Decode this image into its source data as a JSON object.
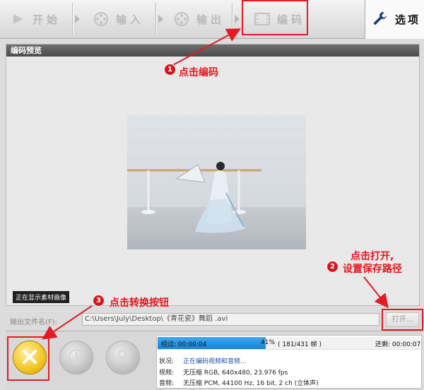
{
  "toolbar": {
    "start_label": "开始",
    "input_label": "输入",
    "output_label": "输出",
    "encode_label": "编码",
    "options_label": "选项"
  },
  "preview": {
    "header": "编码预览",
    "status_overlay": "正在显示素材画像"
  },
  "output_file": {
    "label": "输出文件名(F):",
    "value": "C:\\Users\\July\\Desktop\\《青花瓷》舞蹈 .avi",
    "open_label": "打开..."
  },
  "progress": {
    "elapsed_label": "经过:",
    "elapsed": "00:00:04",
    "percent": "41%",
    "fraction_pct": 41,
    "frames": "( 181/431 帧 )",
    "remaining_label": "还剩:",
    "remaining": "00:00:07"
  },
  "info": {
    "status_key": "状况:",
    "status_val": "正在编码视频和音频...",
    "video_key": "视频:",
    "video_val": "无压缩 RGB, 640x480, 23.976 fps",
    "audio_key": "音频:",
    "audio_val": "无压缩 PCM, 44100 Hz, 16 bit, 2 ch (立体声)"
  },
  "annotations": {
    "step1_num": "1",
    "step1_text": "点击编码",
    "step2_num": "2",
    "step2_text_line1": "点击打开,",
    "step2_text_line2": "设置保存路径",
    "step3_num": "3",
    "step3_text": "点击转换按钮"
  },
  "colors": {
    "annotation_red": "#e31b23",
    "progress_blue": "#1583d6",
    "convert_yellow": "#f5c82a"
  },
  "icons": [
    "play-icon",
    "film-reel-icon",
    "film-strip-icon",
    "wrench-icon",
    "close-x-icon",
    "clock-icon",
    "person-icon"
  ]
}
